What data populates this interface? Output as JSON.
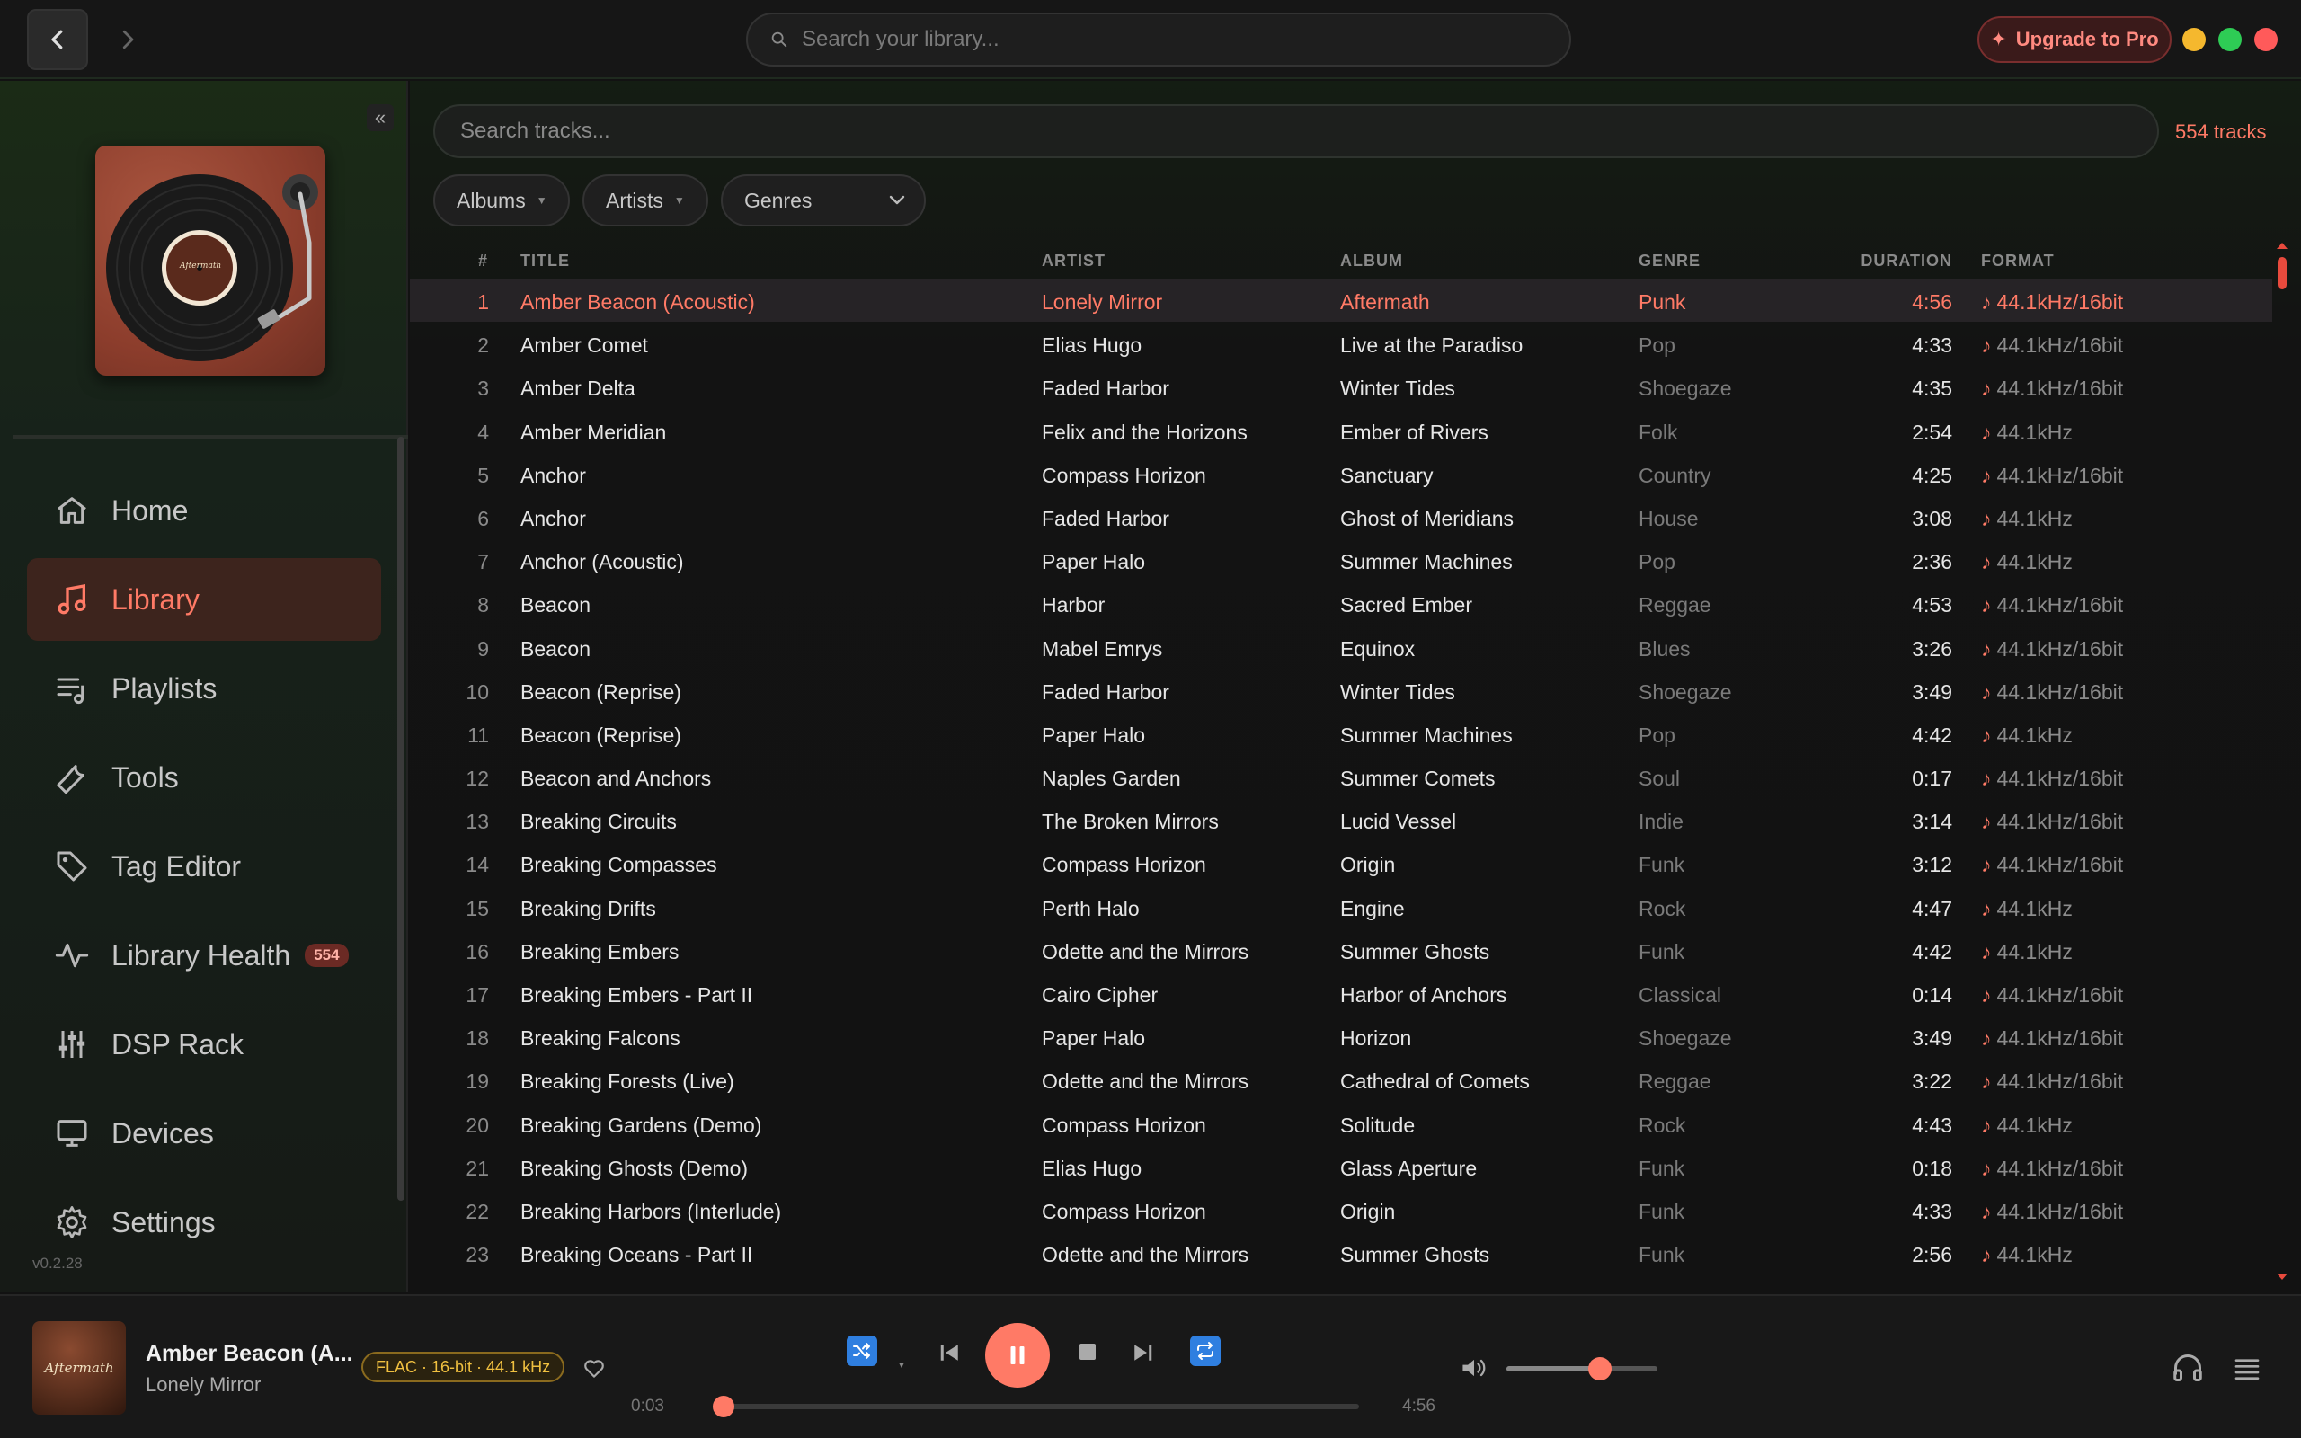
{
  "titlebar": {
    "search_placeholder": "Search your library...",
    "upgrade_label": "Upgrade to Pro",
    "upgrade_icon": "✦"
  },
  "sidebar": {
    "album_text": "Aftermath",
    "items": [
      {
        "label": "Home",
        "icon": "home-icon"
      },
      {
        "label": "Library",
        "icon": "music-note-icon",
        "active": true
      },
      {
        "label": "Playlists",
        "icon": "playlist-icon"
      },
      {
        "label": "Tools",
        "icon": "wrench-icon"
      },
      {
        "label": "Tag Editor",
        "icon": "tag-icon"
      },
      {
        "label": "Library Health",
        "icon": "pulse-icon",
        "badge": "554"
      },
      {
        "label": "DSP Rack",
        "icon": "sliders-icon"
      },
      {
        "label": "Devices",
        "icon": "monitor-icon"
      },
      {
        "label": "Settings",
        "icon": "gear-icon"
      }
    ],
    "version": "v0.2.28",
    "collapse_glyph": "«"
  },
  "library": {
    "search_placeholder": "Search tracks...",
    "track_count": "554 tracks",
    "filters": {
      "albums": "Albums",
      "artists": "Artists",
      "genres": "Genres"
    },
    "columns": {
      "num": "#",
      "title": "TITLE",
      "artist": "ARTIST",
      "album": "ALBUM",
      "genre": "GENRE",
      "duration": "DURATION",
      "format": "FORMAT"
    },
    "rows": [
      {
        "num": "1",
        "title": "Amber Beacon (Acoustic)",
        "artist": "Lonely Mirror",
        "album": "Aftermath",
        "genre": "Punk",
        "duration": "4:56",
        "format": "44.1kHz/16bit",
        "playing": true
      },
      {
        "num": "2",
        "title": "Amber Comet",
        "artist": "Elias Hugo",
        "album": "Live at the Paradiso",
        "genre": "Pop",
        "duration": "4:33",
        "format": "44.1kHz/16bit"
      },
      {
        "num": "3",
        "title": "Amber Delta",
        "artist": "Faded Harbor",
        "album": "Winter Tides",
        "genre": "Shoegaze",
        "duration": "4:35",
        "format": "44.1kHz/16bit"
      },
      {
        "num": "4",
        "title": "Amber Meridian",
        "artist": "Felix and the Horizons",
        "album": "Ember of Rivers",
        "genre": "Folk",
        "duration": "2:54",
        "format": "44.1kHz"
      },
      {
        "num": "5",
        "title": "Anchor",
        "artist": "Compass Horizon",
        "album": "Sanctuary",
        "genre": "Country",
        "duration": "4:25",
        "format": "44.1kHz/16bit"
      },
      {
        "num": "6",
        "title": "Anchor",
        "artist": "Faded Harbor",
        "album": "Ghost of Meridians",
        "genre": "House",
        "duration": "3:08",
        "format": "44.1kHz"
      },
      {
        "num": "7",
        "title": "Anchor (Acoustic)",
        "artist": "Paper Halo",
        "album": "Summer Machines",
        "genre": "Pop",
        "duration": "2:36",
        "format": "44.1kHz"
      },
      {
        "num": "8",
        "title": "Beacon",
        "artist": "Harbor",
        "album": "Sacred Ember",
        "genre": "Reggae",
        "duration": "4:53",
        "format": "44.1kHz/16bit"
      },
      {
        "num": "9",
        "title": "Beacon",
        "artist": "Mabel Emrys",
        "album": "Equinox",
        "genre": "Blues",
        "duration": "3:26",
        "format": "44.1kHz/16bit"
      },
      {
        "num": "10",
        "title": "Beacon (Reprise)",
        "artist": "Faded Harbor",
        "album": "Winter Tides",
        "genre": "Shoegaze",
        "duration": "3:49",
        "format": "44.1kHz/16bit"
      },
      {
        "num": "11",
        "title": "Beacon (Reprise)",
        "artist": "Paper Halo",
        "album": "Summer Machines",
        "genre": "Pop",
        "duration": "4:42",
        "format": "44.1kHz"
      },
      {
        "num": "12",
        "title": "Beacon and Anchors",
        "artist": "Naples Garden",
        "album": "Summer Comets",
        "genre": "Soul",
        "duration": "0:17",
        "format": "44.1kHz/16bit"
      },
      {
        "num": "13",
        "title": "Breaking Circuits",
        "artist": "The Broken Mirrors",
        "album": "Lucid Vessel",
        "genre": "Indie",
        "duration": "3:14",
        "format": "44.1kHz/16bit"
      },
      {
        "num": "14",
        "title": "Breaking Compasses",
        "artist": "Compass Horizon",
        "album": "Origin",
        "genre": "Funk",
        "duration": "3:12",
        "format": "44.1kHz/16bit"
      },
      {
        "num": "15",
        "title": "Breaking Drifts",
        "artist": "Perth Halo",
        "album": "Engine",
        "genre": "Rock",
        "duration": "4:47",
        "format": "44.1kHz"
      },
      {
        "num": "16",
        "title": "Breaking Embers",
        "artist": "Odette and the Mirrors",
        "album": "Summer Ghosts",
        "genre": "Funk",
        "duration": "4:42",
        "format": "44.1kHz"
      },
      {
        "num": "17",
        "title": "Breaking Embers - Part II",
        "artist": "Cairo Cipher",
        "album": "Harbor of Anchors",
        "genre": "Classical",
        "duration": "0:14",
        "format": "44.1kHz/16bit"
      },
      {
        "num": "18",
        "title": "Breaking Falcons",
        "artist": "Paper Halo",
        "album": "Horizon",
        "genre": "Shoegaze",
        "duration": "3:49",
        "format": "44.1kHz/16bit"
      },
      {
        "num": "19",
        "title": "Breaking Forests (Live)",
        "artist": "Odette and the Mirrors",
        "album": "Cathedral of Comets",
        "genre": "Reggae",
        "duration": "3:22",
        "format": "44.1kHz/16bit"
      },
      {
        "num": "20",
        "title": "Breaking Gardens (Demo)",
        "artist": "Compass Horizon",
        "album": "Solitude",
        "genre": "Rock",
        "duration": "4:43",
        "format": "44.1kHz"
      },
      {
        "num": "21",
        "title": "Breaking Ghosts (Demo)",
        "artist": "Elias Hugo",
        "album": "Glass Aperture",
        "genre": "Funk",
        "duration": "0:18",
        "format": "44.1kHz/16bit"
      },
      {
        "num": "22",
        "title": "Breaking Harbors (Interlude)",
        "artist": "Compass Horizon",
        "album": "Origin",
        "genre": "Funk",
        "duration": "4:33",
        "format": "44.1kHz/16bit"
      },
      {
        "num": "23",
        "title": "Breaking Oceans - Part II",
        "artist": "Odette and the Mirrors",
        "album": "Summer Ghosts",
        "genre": "Funk",
        "duration": "2:56",
        "format": "44.1kHz"
      }
    ]
  },
  "player": {
    "art_text": "Aftermath",
    "title": "Amber Beacon (A...",
    "artist": "Lonely Mirror",
    "format_badge": "FLAC · 16-bit · 44.1 kHz",
    "current_time": "0:03",
    "total_time": "4:56",
    "progress_fraction": 0.01,
    "volume_fraction": 0.62
  },
  "colors": {
    "accent": "#ff7a66",
    "blue_toggle": "#2f7fe0",
    "badge_gold": "#f0c040"
  }
}
